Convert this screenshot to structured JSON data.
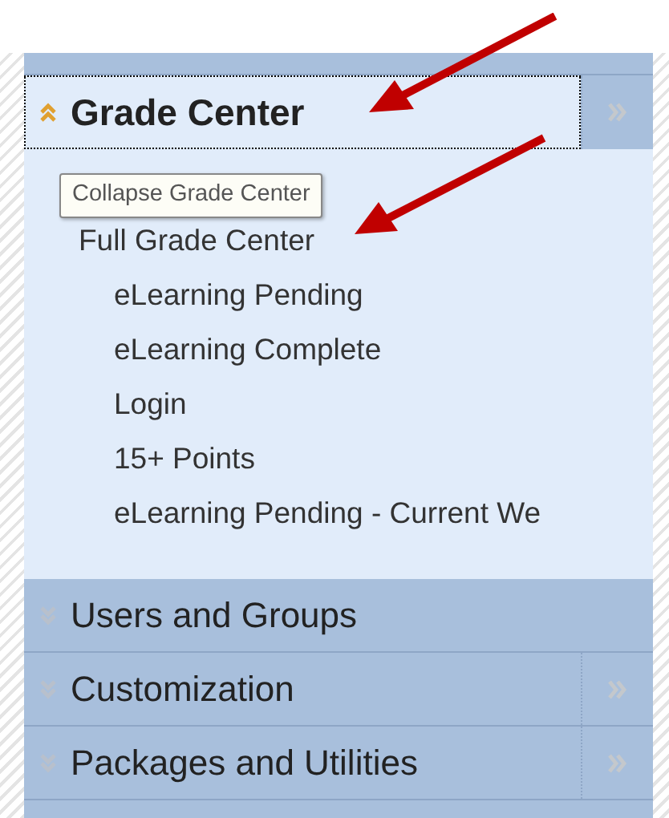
{
  "sections": [
    {
      "title": "Grade Center",
      "expanded": true,
      "focused": true,
      "has_menu": true,
      "tooltip": "Collapse Grade Center",
      "items": [
        {
          "label": "Full Grade Center",
          "children": [
            {
              "label": "eLearning Pending"
            },
            {
              "label": "eLearning Complete"
            },
            {
              "label": "Login"
            },
            {
              "label": "15+ Points"
            },
            {
              "label": "eLearning Pending - Current We"
            }
          ]
        }
      ]
    },
    {
      "title": "Users and Groups",
      "expanded": false,
      "focused": false,
      "has_menu": false
    },
    {
      "title": "Customization",
      "expanded": false,
      "focused": false,
      "has_menu": true
    },
    {
      "title": "Packages and Utilities",
      "expanded": false,
      "focused": false,
      "has_menu": true
    }
  ]
}
